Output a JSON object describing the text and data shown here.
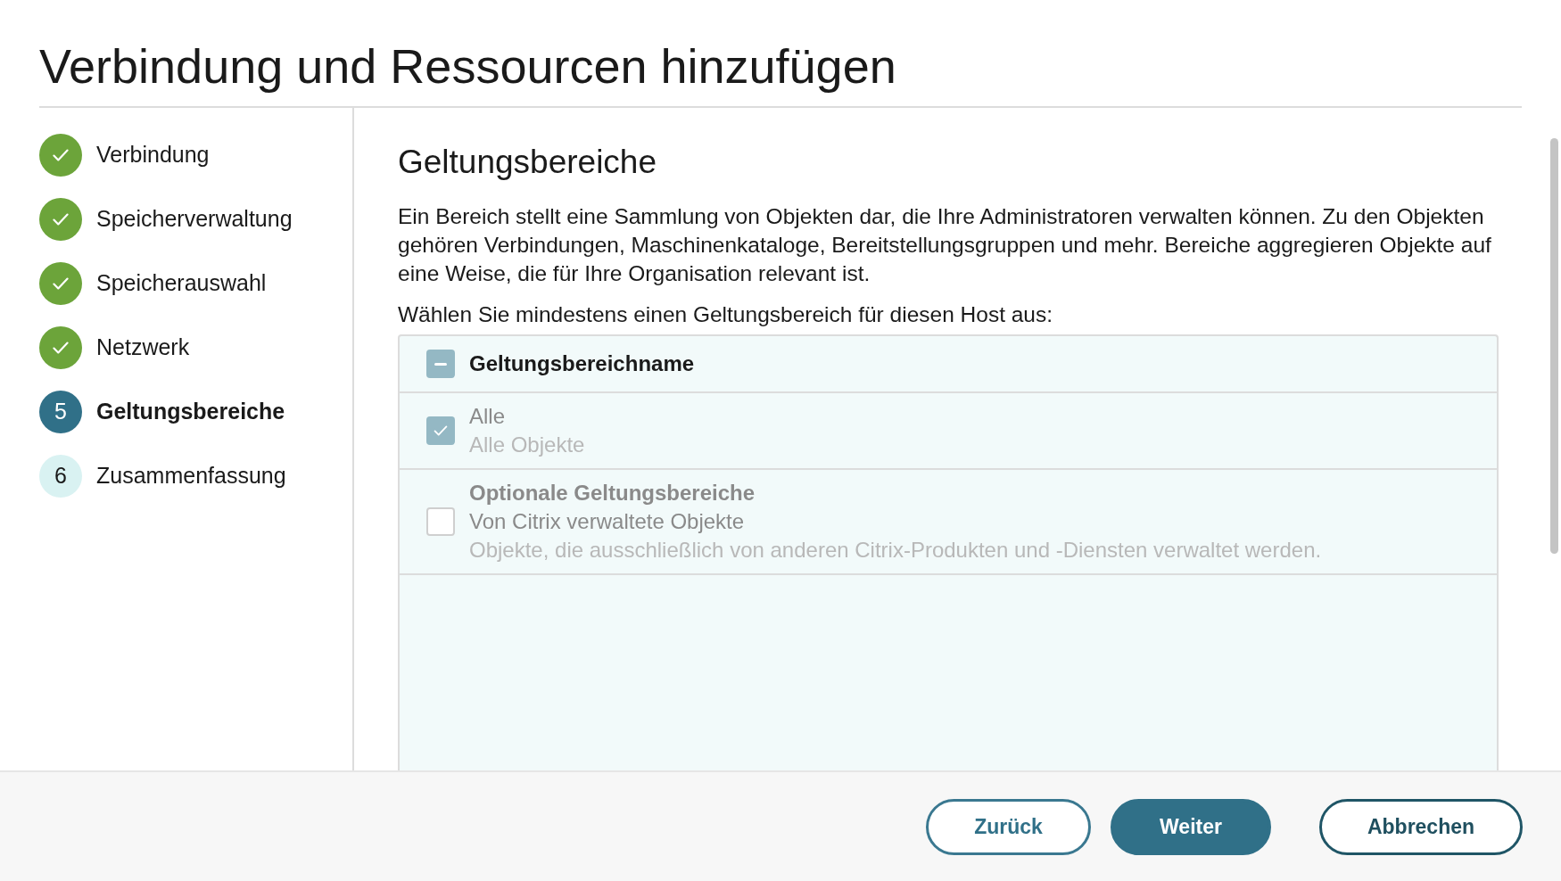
{
  "title": "Verbindung und Ressourcen hinzufügen",
  "steps": [
    {
      "label": "Verbindung",
      "completed": true,
      "selected": false
    },
    {
      "label": "Speicherverwaltung",
      "completed": true,
      "selected": false
    },
    {
      "label": "Speicherauswahl",
      "completed": true,
      "selected": false
    },
    {
      "label": "Netzwerk",
      "completed": true,
      "selected": false
    },
    {
      "number": "5",
      "label": "Geltungsbereiche",
      "completed": false,
      "selected": true
    },
    {
      "number": "6",
      "label": "Zusammenfassung",
      "completed": false,
      "selected": false
    }
  ],
  "section": {
    "heading": "Geltungsbereiche",
    "description": "Ein Bereich stellt eine Sammlung von Objekten dar, die Ihre Administratoren verwalten können. Zu den Objekten gehören Verbindungen, Maschinenkataloge, Bereitstellungsgruppen und mehr. Bereiche aggregieren Objekte auf eine Weise, die für Ihre Organisation relevant ist.",
    "prompt": "Wählen Sie mindestens einen Geltungsbereich für diesen Host aus:"
  },
  "table": {
    "header": {
      "label": "Geltungsbereichname",
      "indeterminate": true
    },
    "rows": [
      {
        "name": "Alle",
        "description": "Alle Objekte",
        "checked": true,
        "disabled": true
      },
      {
        "group": "Optionale Geltungsbereiche",
        "name": "Von Citrix verwaltete Objekte",
        "description": "Objekte, die ausschließlich von anderen Citrix-Produkten und -Diensten verwaltet werden.",
        "checked": false,
        "disabled": false
      }
    ]
  },
  "buttons": [
    {
      "label": "Zurück",
      "kind": "secondary"
    },
    {
      "label": "Weiter",
      "kind": "primary"
    },
    {
      "label": "Abbrechen",
      "kind": "tertiary"
    }
  ]
}
